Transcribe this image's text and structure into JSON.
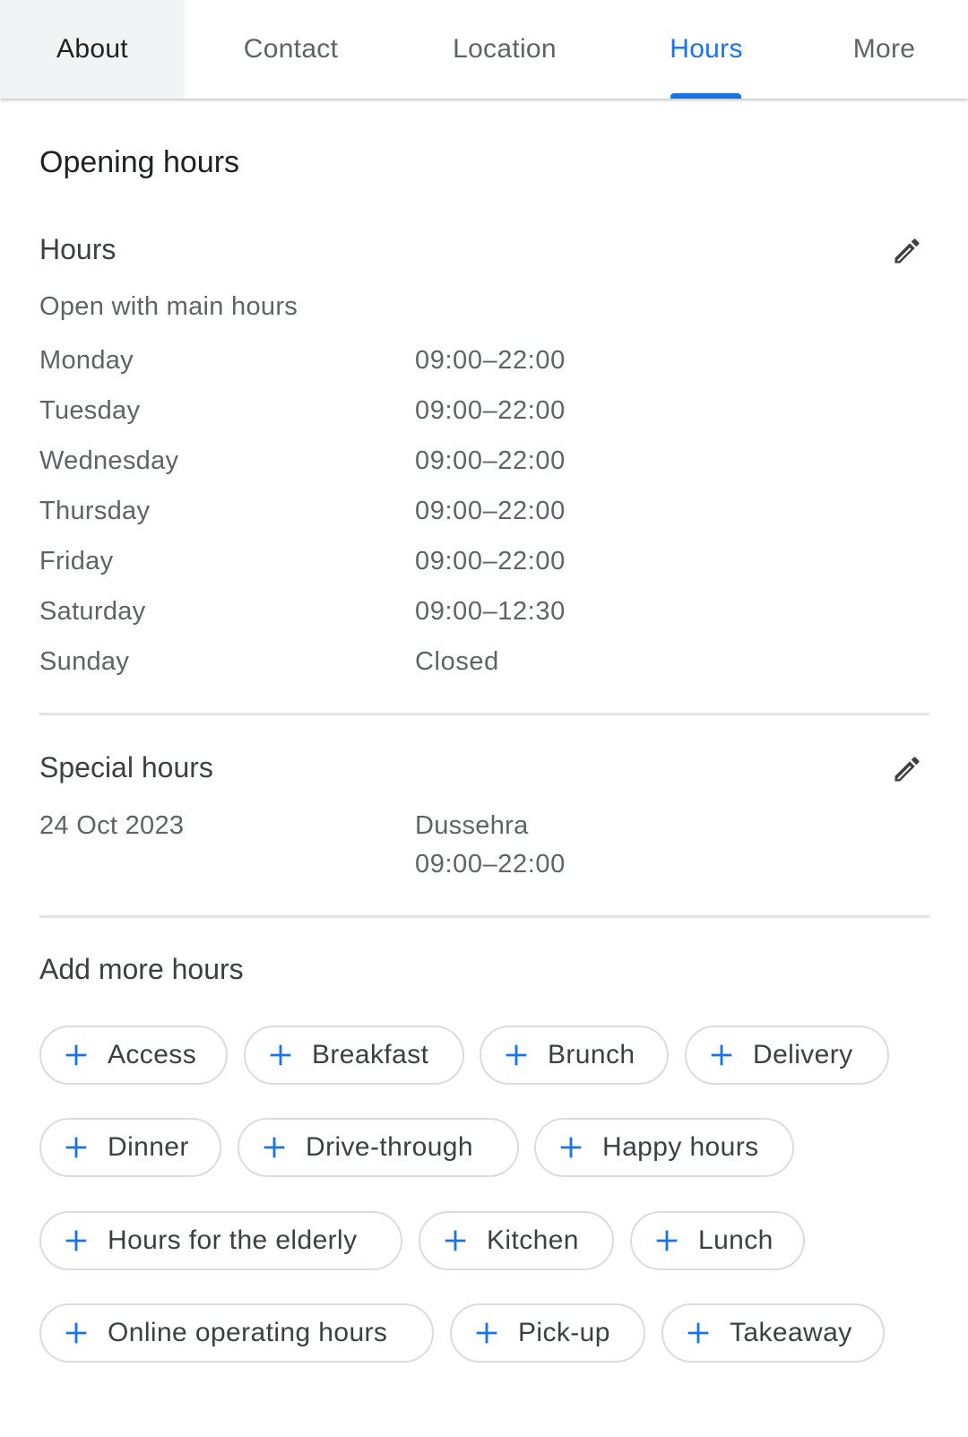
{
  "tabs": [
    {
      "label": "About"
    },
    {
      "label": "Contact"
    },
    {
      "label": "Location"
    },
    {
      "label": "Hours"
    },
    {
      "label": "More"
    }
  ],
  "page": {
    "title": "Opening hours",
    "hours": {
      "title": "Hours",
      "subtitle": "Open with main hours",
      "days": [
        {
          "day": "Monday",
          "time": "09:00–22:00"
        },
        {
          "day": "Tuesday",
          "time": "09:00–22:00"
        },
        {
          "day": "Wednesday",
          "time": "09:00–22:00"
        },
        {
          "day": "Thursday",
          "time": "09:00–22:00"
        },
        {
          "day": "Friday",
          "time": "09:00–22:00"
        },
        {
          "day": "Saturday",
          "time": "09:00–12:30"
        },
        {
          "day": "Sunday",
          "time": "Closed"
        }
      ]
    },
    "special": {
      "title": "Special hours",
      "date": "24 Oct 2023",
      "name": "Dussehra",
      "time": "09:00–22:00"
    },
    "add_more": {
      "title": "Add more hours",
      "chips": [
        "Access",
        "Breakfast",
        "Brunch",
        "Delivery",
        "Dinner",
        "Drive-through",
        "Happy hours",
        "Hours for the elderly",
        "Kitchen",
        "Lunch",
        "Online operating hours",
        "Pick-up",
        "Takeaway"
      ]
    }
  },
  "colors": {
    "accent": "#1a73e8",
    "text_primary": "#202124",
    "text_secondary": "#5f6368",
    "chip_border": "#dadce0"
  },
  "icons": {
    "edit": "pencil-icon",
    "add": "plus-icon"
  }
}
